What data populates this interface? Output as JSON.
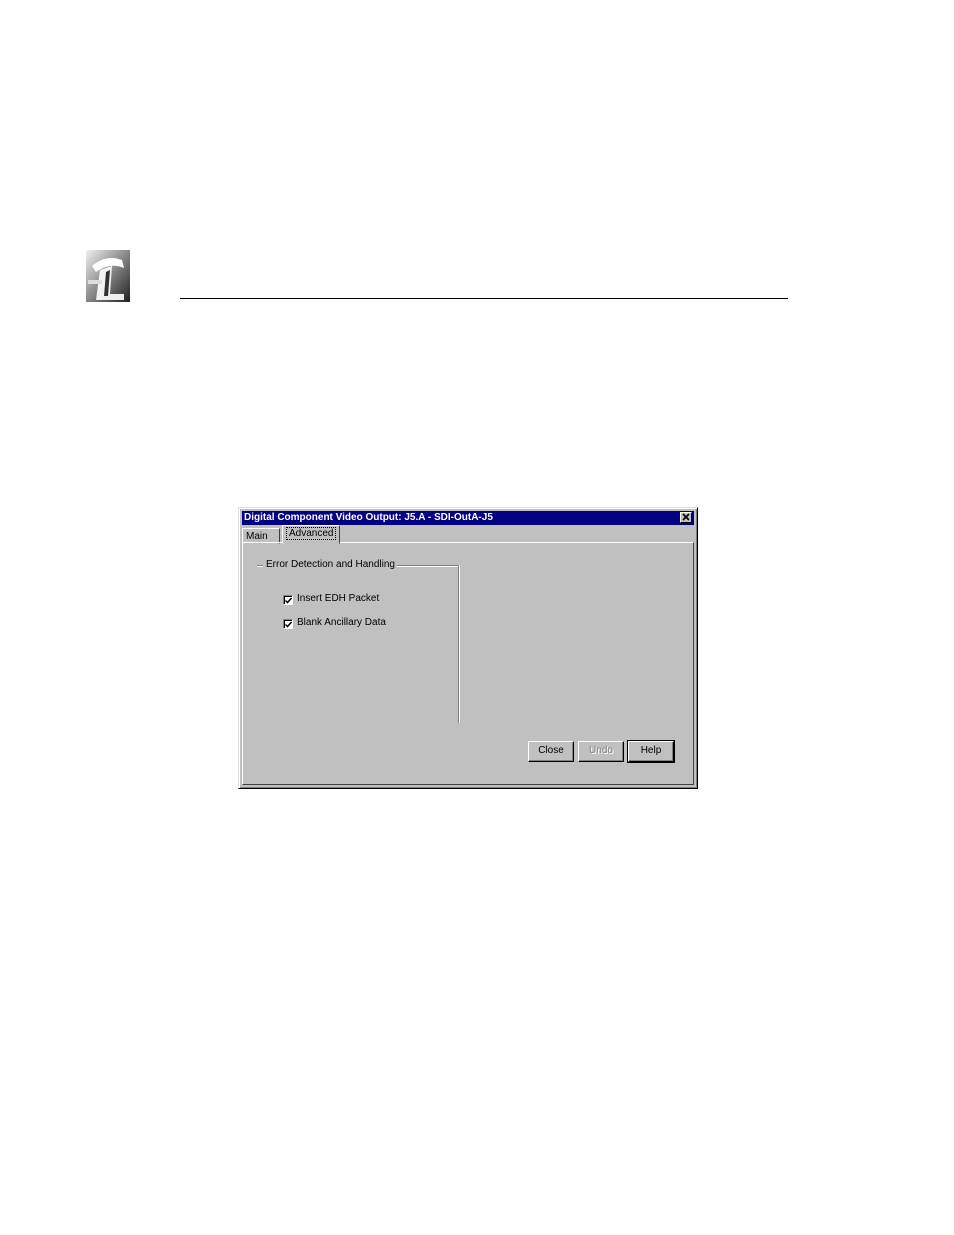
{
  "page": {
    "logo_icon": "company-logo-icon"
  },
  "dialog": {
    "title": "Digital Component Video Output: J5.A - SDI-OutA-J5",
    "close_icon": "close-icon",
    "tabs": [
      {
        "label": "Main",
        "active": false
      },
      {
        "label": "Advanced",
        "active": true
      }
    ],
    "group": {
      "label": "Error Detection and Handling",
      "checkboxes": [
        {
          "label": "Insert EDH Packet",
          "checked": true
        },
        {
          "label": "Blank Ancillary Data",
          "checked": true
        }
      ]
    },
    "buttons": {
      "close": "Close",
      "undo": "Undo",
      "help": "Help"
    },
    "colors": {
      "titlebar": "#000080",
      "face": "#c0c0c0"
    }
  }
}
